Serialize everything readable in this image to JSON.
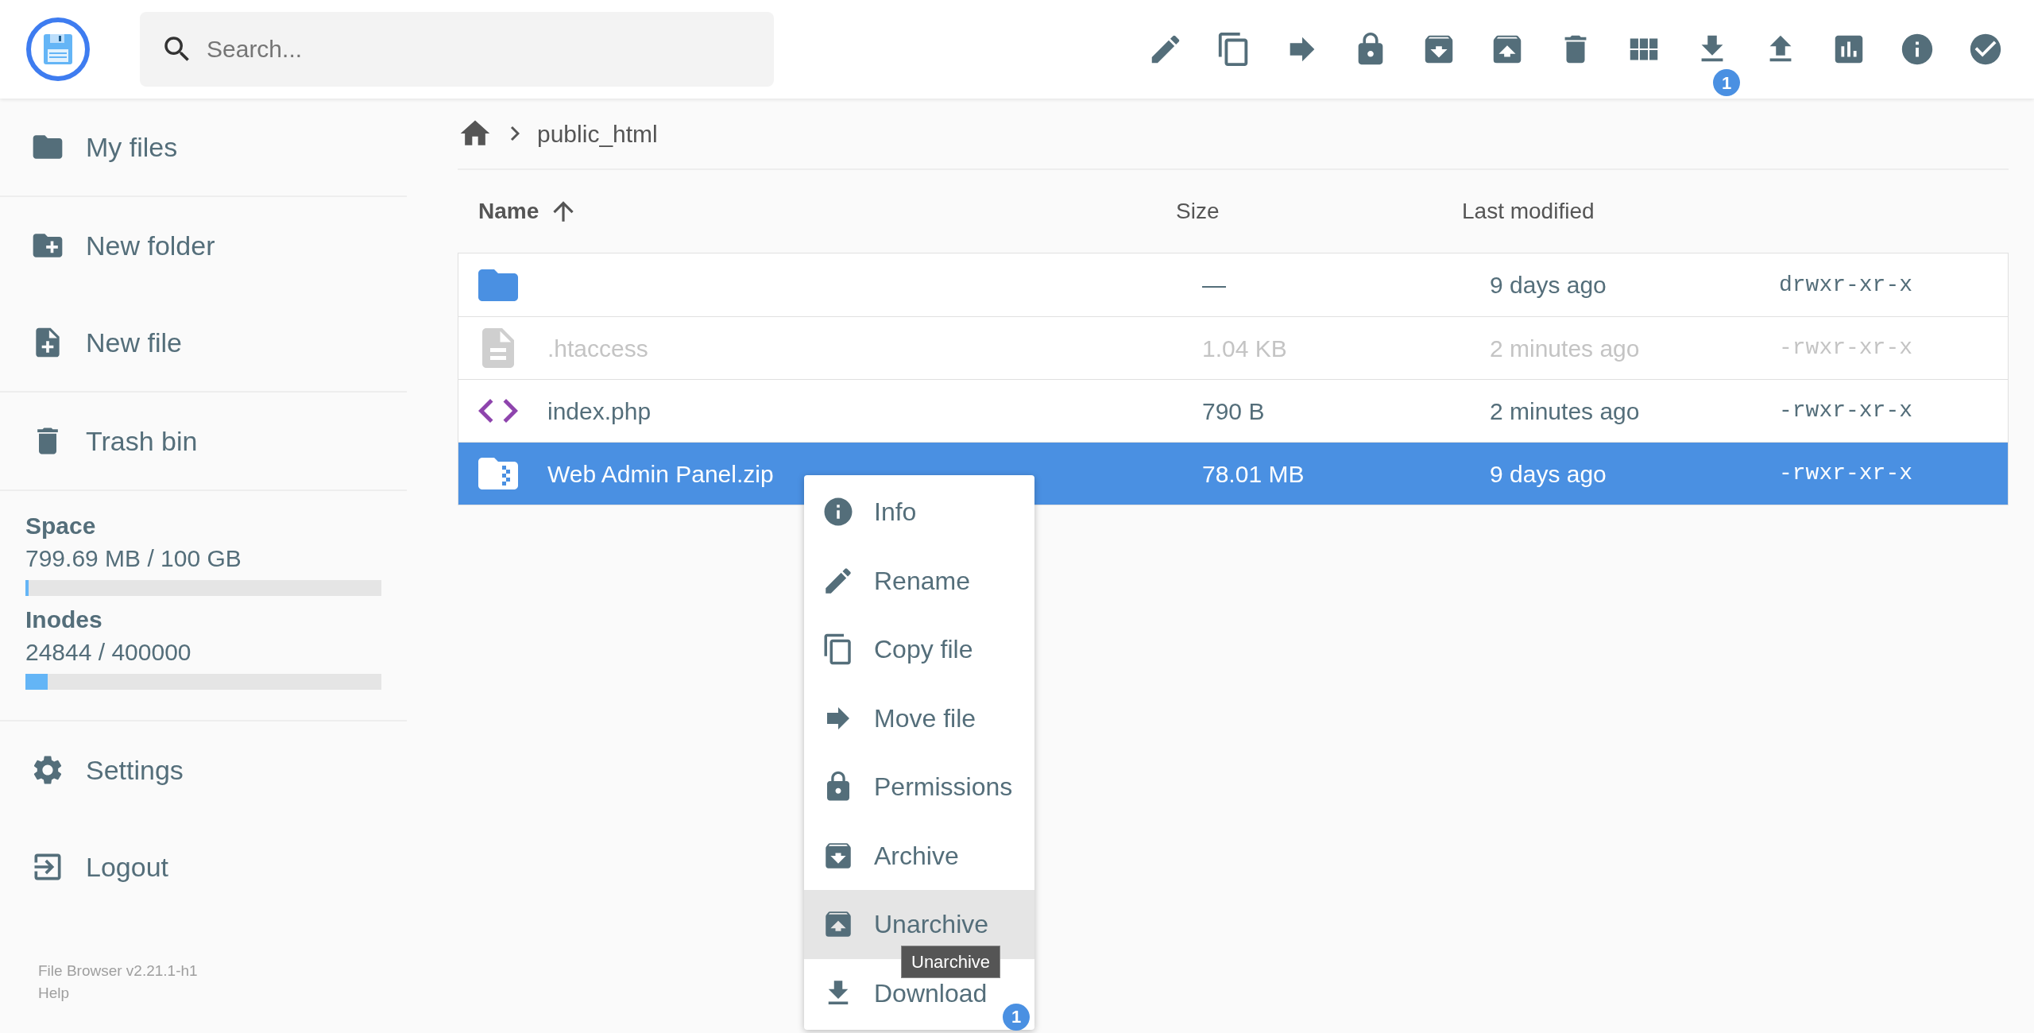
{
  "search": {
    "placeholder": "Search..."
  },
  "toolbar": {
    "download_badge": "1"
  },
  "sidebar": {
    "items": [
      {
        "label": "My files"
      },
      {
        "label": "New folder"
      },
      {
        "label": "New file"
      },
      {
        "label": "Trash bin"
      }
    ],
    "usage": [
      {
        "title": "Space",
        "reading": "799.69 MB / 100 GB",
        "level": 0.008
      },
      {
        "title": "Inodes",
        "reading": "24844 / 400000",
        "level": 0.062
      }
    ],
    "bottom_items": [
      {
        "label": "Settings"
      },
      {
        "label": "Logout"
      }
    ],
    "footer": [
      "File Browser v2.21.1-h1",
      "Help"
    ]
  },
  "breadcrumb": [
    "public_html"
  ],
  "table": {
    "columns": [
      "Name",
      "Size",
      "Last modified"
    ],
    "rows": [
      {
        "kind": "folder",
        "name": "",
        "size": "—",
        "modified": "9 days ago",
        "permissions": "drwxr-xr-x",
        "selected": false,
        "dimmed": false
      },
      {
        "kind": "text",
        "name": ".htaccess",
        "size": "1.04 KB",
        "modified": "2 minutes ago",
        "permissions": "-rwxr-xr-x",
        "selected": false,
        "dimmed": true
      },
      {
        "kind": "code",
        "name": "index.php",
        "size": "790 B",
        "modified": "2 minutes ago",
        "permissions": "-rwxr-xr-x",
        "selected": false,
        "dimmed": false
      },
      {
        "kind": "zip",
        "name": "Web Admin Panel.zip",
        "size": "78.01 MB",
        "modified": "9 days ago",
        "permissions": "-rwxr-xr-x",
        "selected": true,
        "dimmed": false
      }
    ]
  },
  "context_menu": {
    "items": [
      {
        "label": "Info",
        "highlighted": false
      },
      {
        "label": "Rename",
        "highlighted": false
      },
      {
        "label": "Copy file",
        "highlighted": false
      },
      {
        "label": "Move file",
        "highlighted": false
      },
      {
        "label": "Permissions",
        "highlighted": false
      },
      {
        "label": "Archive",
        "highlighted": false
      },
      {
        "label": "Unarchive",
        "highlighted": true
      },
      {
        "label": "Download",
        "highlighted": false,
        "badge": "1"
      }
    ],
    "tooltip": "Unarchive"
  }
}
